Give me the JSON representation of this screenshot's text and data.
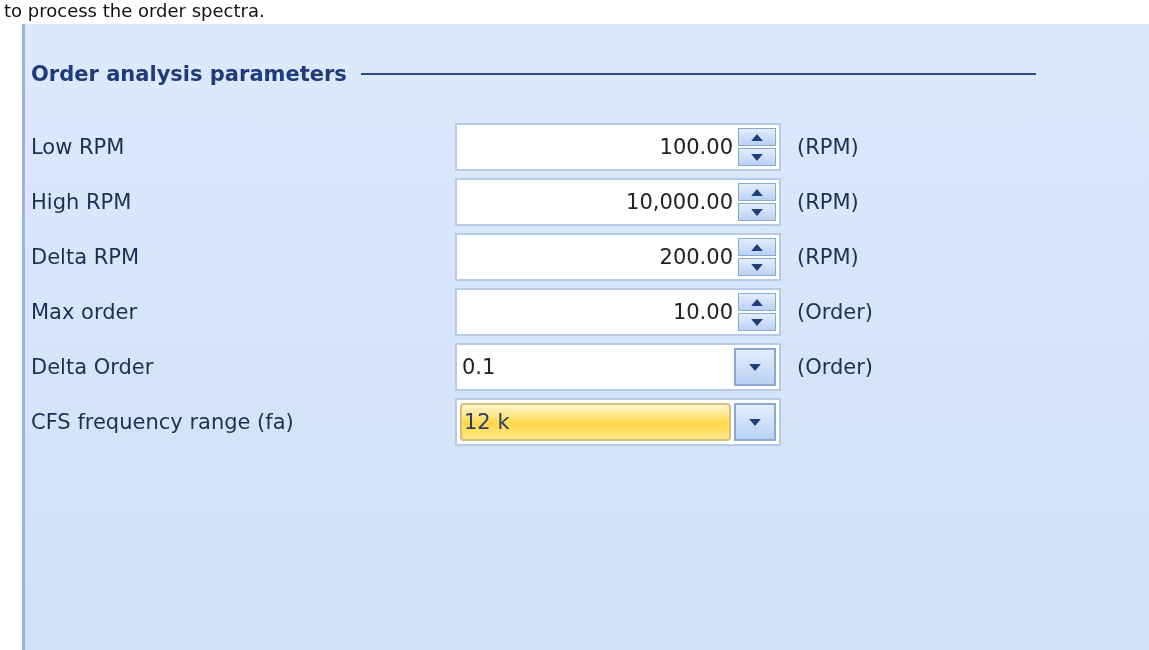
{
  "intro_text": "to process the order spectra.",
  "section": {
    "title": "Order analysis parameters"
  },
  "fields": [
    {
      "label": "Low RPM",
      "kind": "spin",
      "value": "100.00",
      "unit": "(RPM)",
      "focused": false
    },
    {
      "label": "High RPM",
      "kind": "spin",
      "value": "10,000.00",
      "unit": "(RPM)",
      "focused": false
    },
    {
      "label": "Delta RPM",
      "kind": "spin",
      "value": "200.00",
      "unit": "(RPM)",
      "focused": false
    },
    {
      "label": "Max order",
      "kind": "spin",
      "value": "10.00",
      "unit": "(Order)",
      "focused": false
    },
    {
      "label": "Delta Order",
      "kind": "combo",
      "value": "0.1",
      "unit": "(Order)",
      "focused": false
    },
    {
      "label": "CFS frequency range (fa)",
      "kind": "combo",
      "value": "12 k",
      "focused": true
    }
  ]
}
